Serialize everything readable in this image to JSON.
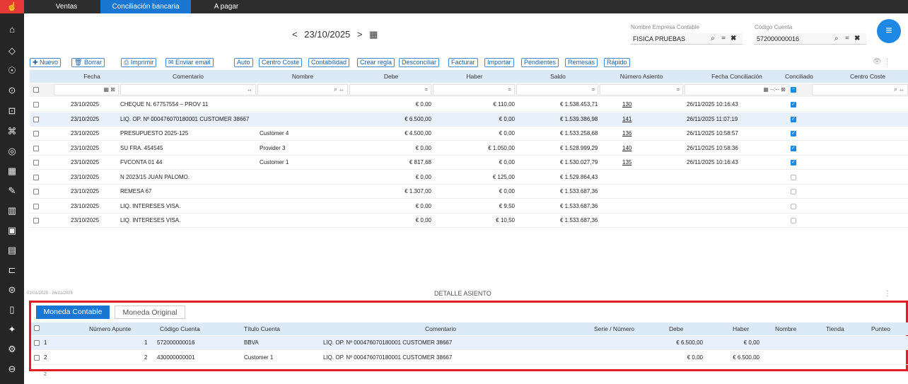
{
  "top_tabs": [
    "Ventas",
    "Conciliación bancaria",
    "A pagar"
  ],
  "date_nav": {
    "prev": "<",
    "date": "23/10/2025",
    "next": ">"
  },
  "company": {
    "label": "Nombre Empresa Contable",
    "value": "FISICA PRUEBAS"
  },
  "account": {
    "label": "Código Cuenta",
    "value": "572000000016"
  },
  "equals": "=",
  "toolbar": [
    "Nuevo",
    "Borrar",
    "Imprimir",
    "Enviar email",
    "Auto",
    "Centro Coste",
    "Contabilidad",
    "Crear regla",
    "Desconciliar",
    "Facturar",
    "Importar",
    "Pendientes",
    "Remesas",
    "Rápido"
  ],
  "columns": [
    "Fecha",
    "Comentario",
    "Nombre",
    "Debe",
    "Haber",
    "Saldo",
    "Número Asiento",
    "Fecha Conciliación",
    "Conciliado",
    "Centro Coste"
  ],
  "filters": {
    "eq": "=",
    "arrow": "↔",
    "time": "--:--"
  },
  "rows": [
    {
      "fecha": "23/10/2025",
      "comentario": "CHEQUE N. 67757554 – PROV 11",
      "nombre": "",
      "debe": "€ 0,00",
      "haber": "€ 110,00",
      "saldo": "€ 1.538.453,71",
      "asiento": "130",
      "fconc": "26/11/2025 10:16:43",
      "conciliado": true
    },
    {
      "fecha": "23/10/2025",
      "comentario": "LIQ. OP. Nº 000476070180001 CUSTOMER 38667",
      "nombre": "",
      "debe": "€ 6.500,00",
      "haber": "€ 0,00",
      "saldo": "€ 1.539.386,98",
      "asiento": "141",
      "fconc": "26/11/2025 11:07:19",
      "conciliado": true
    },
    {
      "fecha": "23/10/2025",
      "comentario": "PRESUPUESTO 2025-125",
      "nombre": "Customer 4",
      "debe": "€ 4.500,00",
      "haber": "€ 0,00",
      "saldo": "€ 1.533.258,68",
      "asiento": "136",
      "fconc": "26/11/2025 10:58:57",
      "conciliado": true
    },
    {
      "fecha": "23/10/2025",
      "comentario": "SU FRA. 454545",
      "nombre": "Provider 3",
      "debe": "€ 0,00",
      "haber": "€ 1.050,00",
      "saldo": "€ 1.528.999,29",
      "asiento": "140",
      "fconc": "26/11/2025 10:58:36",
      "conciliado": true
    },
    {
      "fecha": "23/10/2025",
      "comentario": "FVCONTA 01 44",
      "nombre": "Customer 1",
      "debe": "€ 817,68",
      "haber": "€ 0,00",
      "saldo": "€ 1.530.027,79",
      "asiento": "135",
      "fconc": "26/11/2025 10:16:43",
      "conciliado": true
    },
    {
      "fecha": "23/10/2025",
      "comentario": "N 2023/15 JUAN PALOMO.",
      "nombre": "",
      "debe": "€ 0,00",
      "haber": "€ 125,00",
      "saldo": "€ 1.529.864,43",
      "asiento": "",
      "fconc": "",
      "conciliado": false
    },
    {
      "fecha": "23/10/2025",
      "comentario": "REMESA 67",
      "nombre": "",
      "debe": "€ 1.307,00",
      "haber": "€ 0,00",
      "saldo": "€ 1.533.687,36",
      "asiento": "",
      "fconc": "",
      "conciliado": false
    },
    {
      "fecha": "23/10/2025",
      "comentario": "LIQ. INTERESES VISA.",
      "nombre": "",
      "debe": "€ 0,00",
      "haber": "€ 9,50",
      "saldo": "€ 1.533.687,36",
      "asiento": "",
      "fconc": "",
      "conciliado": false
    },
    {
      "fecha": "23/10/2025",
      "comentario": "LIQ. INTERESES VISA.",
      "nombre": "",
      "debe": "€ 0,00",
      "haber": "€ 10,50",
      "saldo": "€ 1.533.687,36",
      "asiento": "",
      "fconc": "",
      "conciliado": false
    }
  ],
  "date_range": "01/01/2025 - 26/11/2025",
  "detail_title": "DETALLE ASIENTO",
  "detail_tabs": [
    "Moneda Contable",
    "Moneda Original"
  ],
  "detail_columns": [
    "Número Apunte",
    "Código Cuenta",
    "Título Cuenta",
    "Comentario",
    "Serie / Número",
    "Debe",
    "Haber",
    "Nombre",
    "Tienda",
    "Punteo"
  ],
  "detail_rows": [
    {
      "idx": "1",
      "apunte": "1",
      "cuenta": "572000000016",
      "titulo": "BBVA",
      "comentario": "LIQ. OP. Nº 000476070180001 CUSTOMER 38667",
      "serie": "",
      "debe": "€ 6.500,00",
      "haber": "€ 0,00"
    },
    {
      "idx": "2",
      "apunte": "2",
      "cuenta": "430000000001",
      "titulo": "Customer 1",
      "comentario": "LIQ. OP. Nº 000476070180001 CUSTOMER 38667",
      "serie": "",
      "debe": "€ 0,00",
      "haber": "€ 6.500,00"
    }
  ],
  "below_text": "2",
  "colors": {
    "accent": "#1976d2",
    "highlight": "#e31b23",
    "header_bg": "#dce9f6"
  },
  "icons": [
    "home-icon",
    "tag-icon",
    "users-icon",
    "euro-icon",
    "truck-icon",
    "org-icon",
    "coins-icon",
    "calculator-icon",
    "edit-icon",
    "chart-icon",
    "id-card-icon",
    "calendar-icon",
    "desk-icon",
    "bank-icon",
    "document-icon",
    "magic-icon",
    "settings-icon",
    "file-icon"
  ]
}
